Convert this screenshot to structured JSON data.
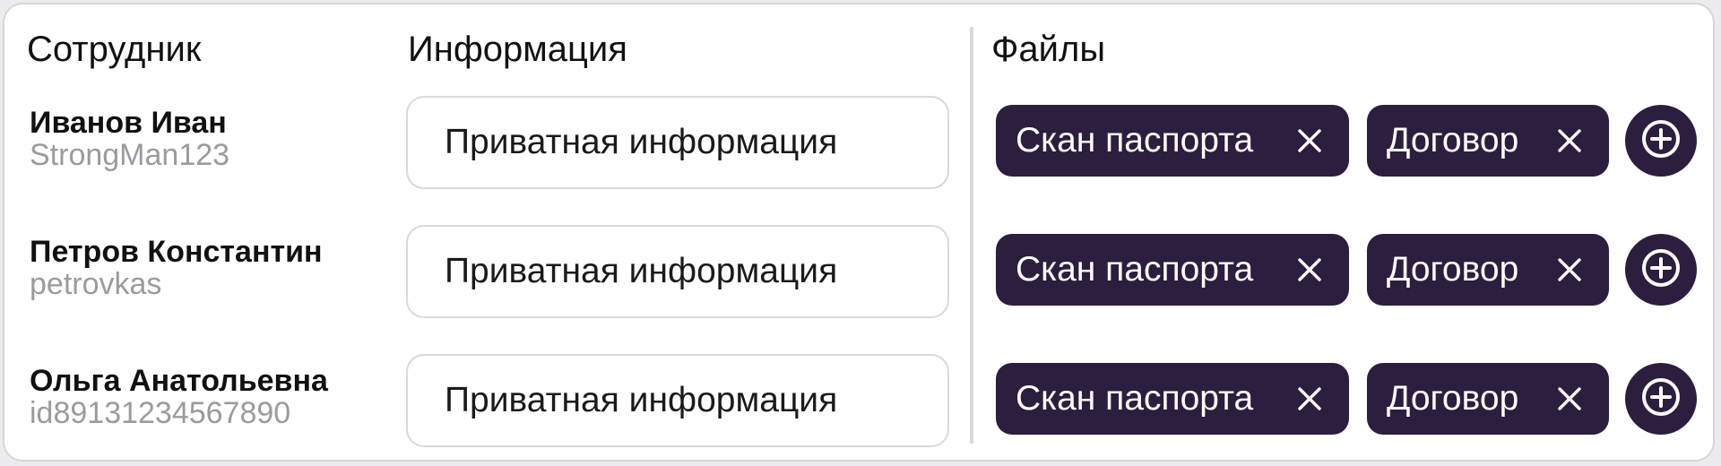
{
  "headers": {
    "employee": "Сотрудник",
    "info": "Информация",
    "files": "Файлы"
  },
  "rows": [
    {
      "name": "Иванов Иван",
      "login": "StrongMan123",
      "info_placeholder": "Приватная информация",
      "files": [
        "Скан паспорта",
        "Договор"
      ]
    },
    {
      "name": "Петров Константин",
      "login": "petrovkas",
      "info_placeholder": "Приватная информация",
      "files": [
        "Скан паспорта",
        "Договор"
      ]
    },
    {
      "name": "Ольга Анатольевна",
      "login": "id89131234567890",
      "info_placeholder": "Приватная информация",
      "files": [
        "Скан паспорта",
        "Договор"
      ]
    }
  ],
  "icons": {
    "chip_remove": "close-icon",
    "add_file": "plus-circle-icon"
  },
  "colors": {
    "chip_bg": "#2c1e3e",
    "chip_text": "#ffffff",
    "login_text": "#9b9b9f",
    "border": "#d9d9db"
  }
}
